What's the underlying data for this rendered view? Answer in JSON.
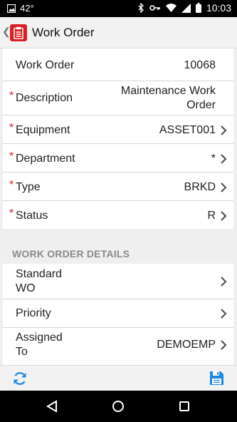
{
  "status_bar": {
    "temperature": "42°",
    "time": "10:03"
  },
  "app_bar": {
    "title": "Work Order"
  },
  "form": {
    "rows": [
      {
        "label": "Work Order",
        "value": "10068",
        "required": false
      },
      {
        "label": "Description",
        "value_line1": "Maintenance Work",
        "value_line2": "Order",
        "required": true
      },
      {
        "label": "Equipment",
        "value": "ASSET001",
        "required": true
      },
      {
        "label": "Department",
        "value": "*",
        "required": true
      },
      {
        "label": "Type",
        "value": "BRKD",
        "required": true
      },
      {
        "label": "Status",
        "value": "R",
        "required": true
      }
    ],
    "required_marker": "*"
  },
  "details": {
    "section_title": "WORK ORDER DETAILS",
    "rows": [
      {
        "label_line1": "Standard",
        "label_line2": "WO",
        "value": ""
      },
      {
        "label": "Priority",
        "value": ""
      },
      {
        "label_line1": "Assigned",
        "label_line2": "To",
        "value": "DEMOEMP"
      }
    ]
  },
  "colors": {
    "accent": "#1e88e5",
    "required": "#d3222a",
    "app_icon": "#d71f26"
  },
  "icons": {
    "refresh": "refresh-icon",
    "save": "save-icon"
  }
}
